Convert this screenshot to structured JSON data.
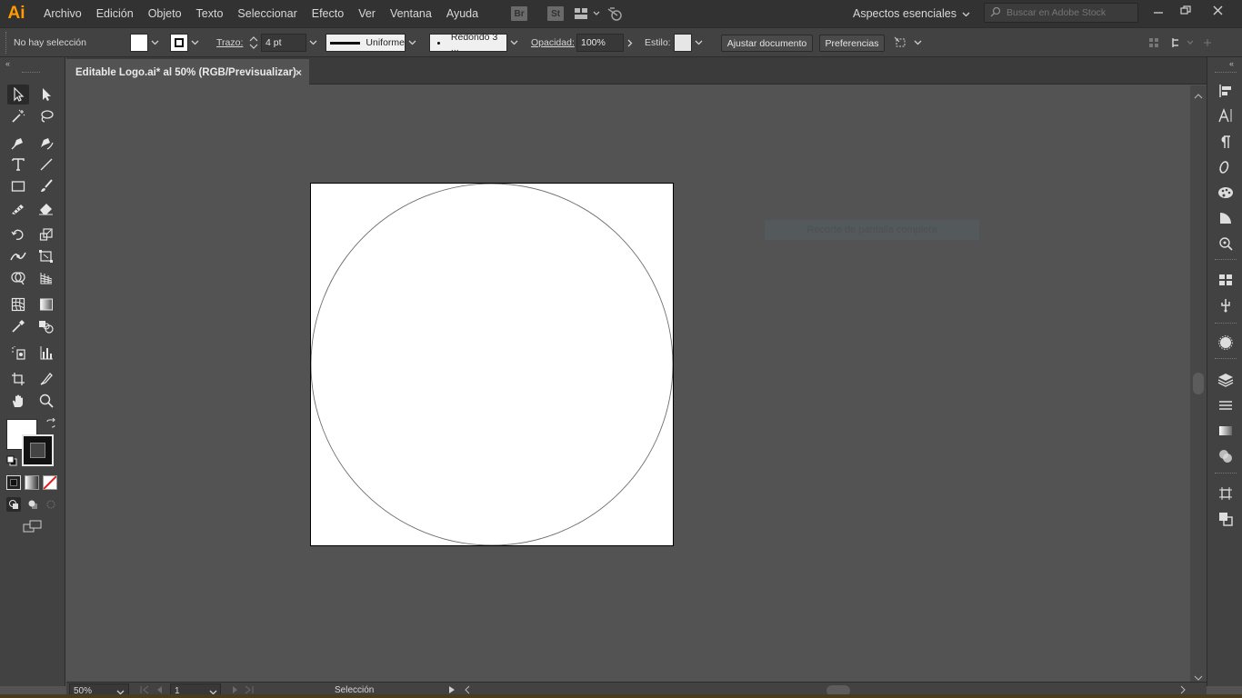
{
  "app": {
    "logo": "Ai"
  },
  "menu": [
    "Archivo",
    "Edición",
    "Objeto",
    "Texto",
    "Seleccionar",
    "Efecto",
    "Ver",
    "Ventana",
    "Ayuda"
  ],
  "bridge_badge": "Br",
  "stock_badge": "St",
  "workspace": {
    "label": "Aspectos esenciales"
  },
  "search": {
    "placeholder": "Buscar en Adobe Stock"
  },
  "control": {
    "selection_status": "No hay selección",
    "stroke_label": "Trazo:",
    "stroke_weight": "4 pt",
    "stroke_profile": "Uniforme",
    "brush": "Redondo 3 ...",
    "opacity_label": "Opacidad:",
    "opacity_value": "100%",
    "style_label": "Estilo:",
    "fit_button": "Ajustar documento",
    "prefs_button": "Preferencias"
  },
  "document": {
    "tab_title": "Editable Logo.ai* al 50% (RGB/Previsualizar)",
    "close": "×"
  },
  "toast": "Recorte de pantalla completa",
  "status": {
    "zoom": "50%",
    "page": "1",
    "tool": "Selección"
  },
  "colors": {
    "accent": "#ff9a00",
    "ui_dark": "#323232",
    "ui_mid": "#424242",
    "canvas": "#535353"
  },
  "icons": {
    "tools": [
      "selection-icon",
      "direct-selection-icon",
      "magic-wand-icon",
      "lasso-icon",
      "pen-icon",
      "curvature-icon",
      "type-icon",
      "line-icon",
      "rectangle-icon",
      "paintbrush-icon",
      "shaper-icon",
      "eraser-icon",
      "rotate-icon",
      "scale-icon",
      "width-icon",
      "free-transform-icon",
      "shape-builder-icon",
      "perspective-grid-icon",
      "mesh-icon",
      "gradient-icon",
      "eyedropper-icon",
      "blend-icon",
      "symbol-sprayer-icon",
      "graph-icon",
      "artboard-icon",
      "slice-icon",
      "hand-icon",
      "zoom-icon"
    ]
  }
}
